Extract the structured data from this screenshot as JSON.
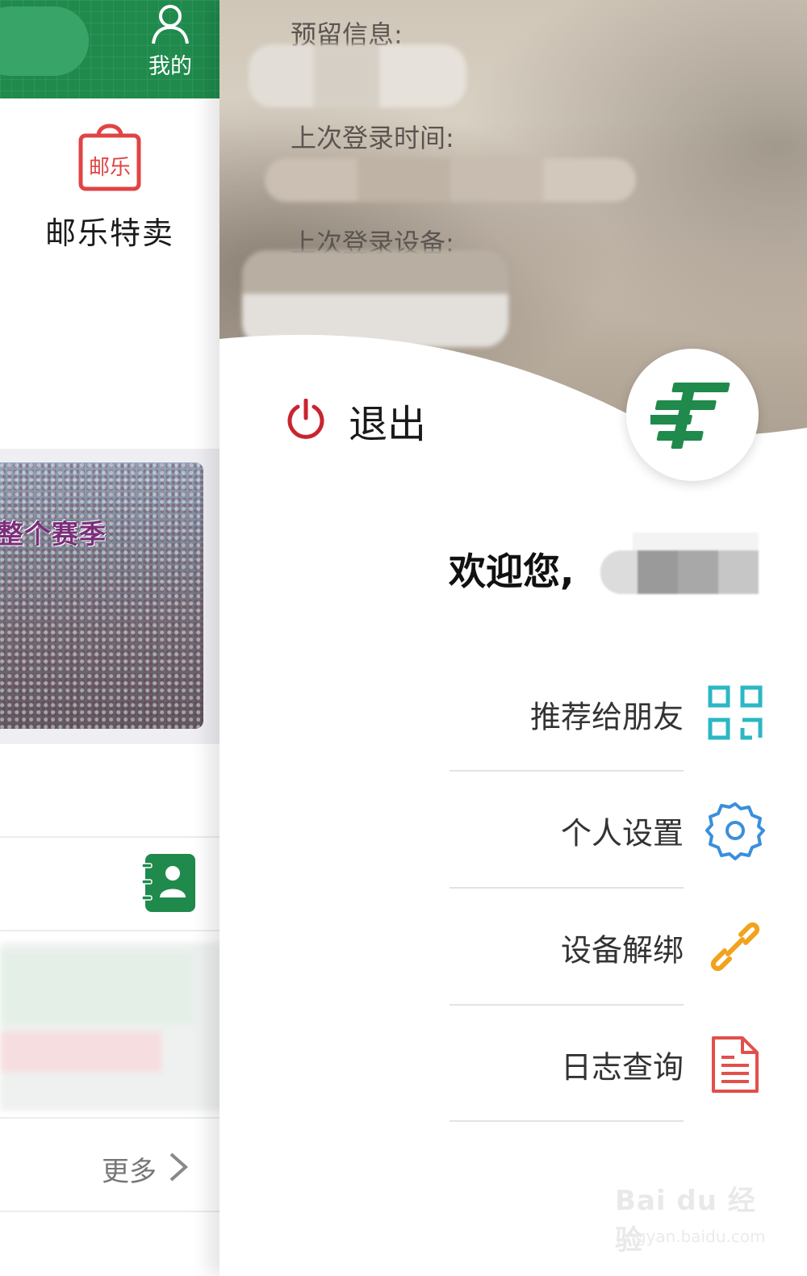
{
  "left": {
    "header": {
      "mine_label": "我的"
    },
    "promo": {
      "icon_text": "邮乐",
      "label": "邮乐特卖"
    },
    "banner": {
      "text": "整个赛季"
    },
    "more": {
      "label": "更多"
    }
  },
  "drawer": {
    "info": {
      "reserved_label": "预留信息:",
      "last_login_time_label": "上次登录时间:",
      "last_login_device_label": "上次登录设备:"
    },
    "logout_label": "退出",
    "welcome_label": "欢迎您,",
    "menu": [
      {
        "label": "推荐给朋友",
        "icon": "qr-code-icon",
        "color": "#2bb7c4"
      },
      {
        "label": "个人设置",
        "icon": "gear-icon",
        "color": "#3a8fdc"
      },
      {
        "label": "设备解绑",
        "icon": "chain-link-icon",
        "color": "#f2a21c"
      },
      {
        "label": "日志查询",
        "icon": "document-icon",
        "color": "#e2504c"
      }
    ],
    "watermark": {
      "text": "Bai du 经验",
      "sub": "jingyan.baidu.com"
    }
  },
  "colors": {
    "brand_green": "#1f8a4c",
    "logout_red": "#c8252f"
  }
}
